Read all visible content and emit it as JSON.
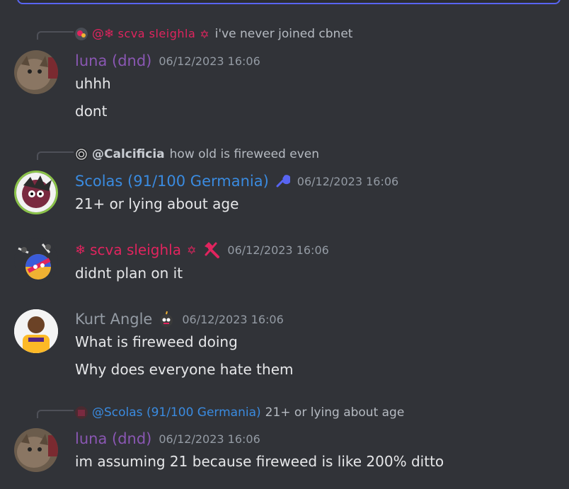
{
  "messages": [
    {
      "reply": {
        "mention": "@",
        "name": "scva sleighla",
        "name_prefix": "❄",
        "text": "i've never joined cbnet"
      },
      "username": "luna (dnd)",
      "timestamp": "06/12/2023 16:06",
      "lines": [
        "uhhh",
        "dont"
      ]
    },
    {
      "reply": {
        "mention": "@Calcificia",
        "text": "how old is fireweed even"
      },
      "username": "Scolas (91/100 Germania)",
      "timestamp": "06/12/2023 16:06",
      "lines": [
        "21+ or lying about age"
      ]
    },
    {
      "username_prefix": "❄",
      "username": "scva sleighla",
      "timestamp": "06/12/2023 16:06",
      "lines": [
        "didnt plan on it"
      ]
    },
    {
      "username": "Kurt Angle",
      "timestamp": "06/12/2023 16:06",
      "lines": [
        "What is fireweed doing",
        "Why does everyone hate them"
      ]
    },
    {
      "reply": {
        "mention": "@Scolas (91/100 Germania)",
        "text": "21+ or lying about age"
      },
      "username": "luna (dnd)",
      "timestamp": "06/12/2023 16:06",
      "lines": [
        "im assuming 21 because fireweed is like 200% ditto"
      ]
    }
  ],
  "colors": {
    "background": "#313338",
    "luna": "#8a57b3",
    "scolas": "#3a8be0",
    "sleighla": "#e0245e",
    "kurt": "#949ba4",
    "timestamp": "#949ba4",
    "text": "#e6e7e9"
  },
  "icons": {
    "scolas_badge": "wrench-icon",
    "sleighla_badge": "hammer-icon",
    "kurt_badge": "bomb-emoji-icon"
  }
}
